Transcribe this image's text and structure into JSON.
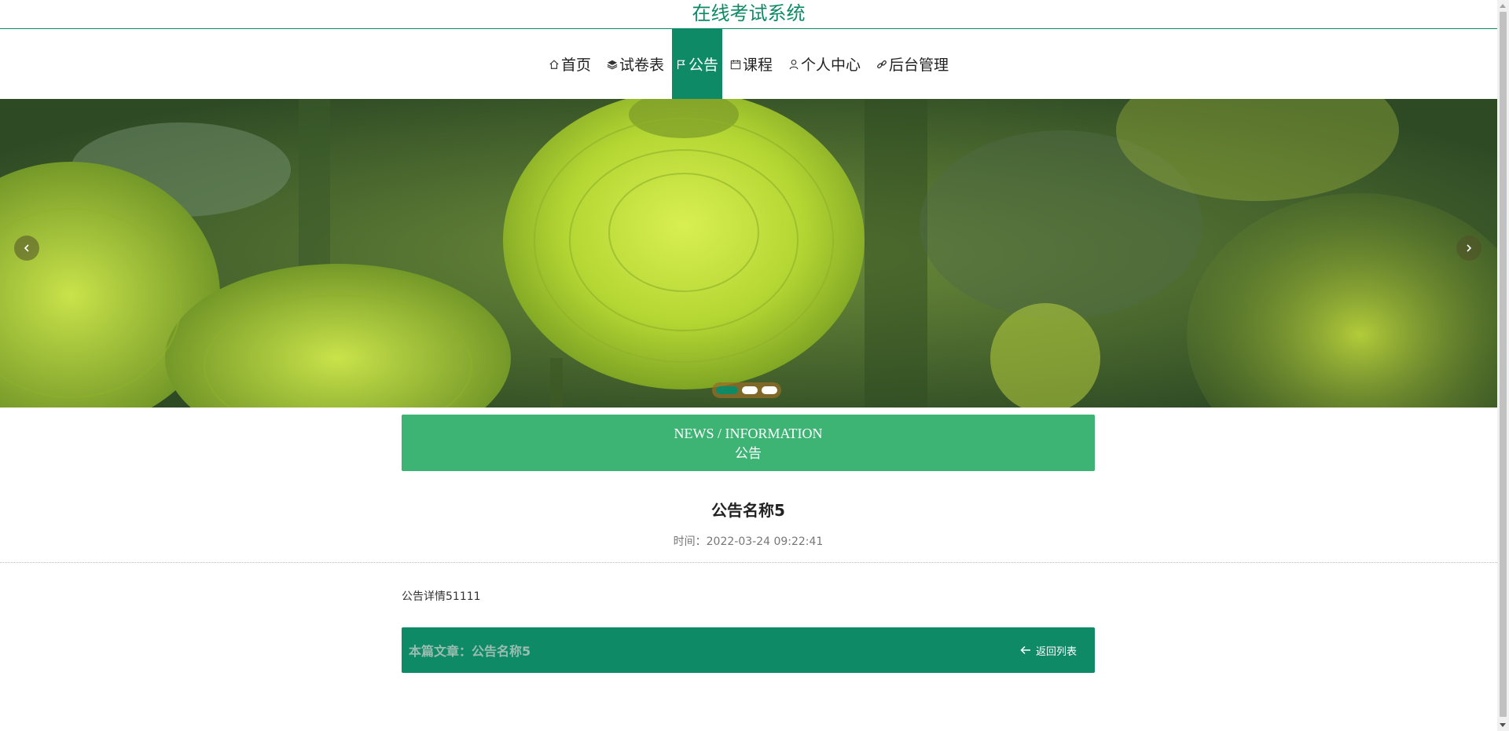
{
  "site": {
    "title": "在线考试系统"
  },
  "nav": {
    "items": [
      {
        "label": "首页",
        "icon": "home-icon"
      },
      {
        "label": "试卷表",
        "icon": "layers-icon"
      },
      {
        "label": "公告",
        "icon": "flag-icon",
        "active": true
      },
      {
        "label": "课程",
        "icon": "calendar-icon"
      },
      {
        "label": "个人中心",
        "icon": "user-icon"
      },
      {
        "label": "后台管理",
        "icon": "link-icon"
      }
    ]
  },
  "carousel": {
    "slide_count": 3,
    "active_index": 0
  },
  "section": {
    "title_en": "NEWS / INFORMATION",
    "title_cn": "公告"
  },
  "article": {
    "title": "公告名称5",
    "time_label": "时间：",
    "time": "2022-03-24 09:22:41",
    "content": "公告详情51111"
  },
  "footer": {
    "current_label": "本篇文章：",
    "current_title": "公告名称5",
    "back_label": "返回列表"
  },
  "colors": {
    "primary": "#0f8a66",
    "section_head": "#3db374"
  }
}
